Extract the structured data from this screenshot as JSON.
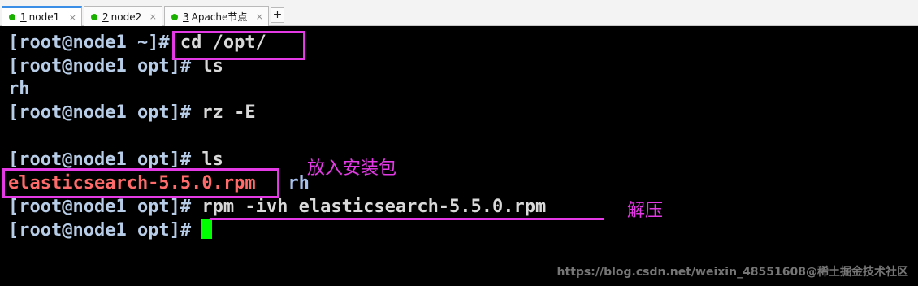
{
  "tabs": [
    {
      "number": "1",
      "label": "node1",
      "close": "×"
    },
    {
      "number": "2",
      "label": "node2",
      "close": "×"
    },
    {
      "number": "3",
      "label": "Apache节点",
      "close": "×"
    }
  ],
  "add_tab_label": "+",
  "terminal": {
    "lines": [
      {
        "prompt": "[root@node1 ~]#",
        "command": " cd /opt/"
      },
      {
        "prompt": "[root@node1 opt]#",
        "command": " ls"
      },
      {
        "output": "rh"
      },
      {
        "prompt": "[root@node1 opt]#",
        "command": " rz -E"
      },
      {
        "prompt": "[root@node1 opt]#",
        "command": " ls"
      },
      {
        "file_red": "elasticsearch-5.5.0.rpm",
        "file_blue": "rh"
      },
      {
        "prompt": "[root@node1 opt]#",
        "command": " rpm -ivh elasticsearch-5.5.0.rpm"
      },
      {
        "prompt": "[root@node1 opt]#",
        "command": " "
      }
    ]
  },
  "annotations": {
    "put_package": "放入安装包",
    "decompress": "解压"
  },
  "watermark": "https://blog.csdn.net/weixin_48551608@稀土掘金技术社区",
  "colors": {
    "annotation": "#e43ae6",
    "cursor": "#00ff00",
    "file_red": "#ff6a6a",
    "tab_dot": "#19b000"
  }
}
